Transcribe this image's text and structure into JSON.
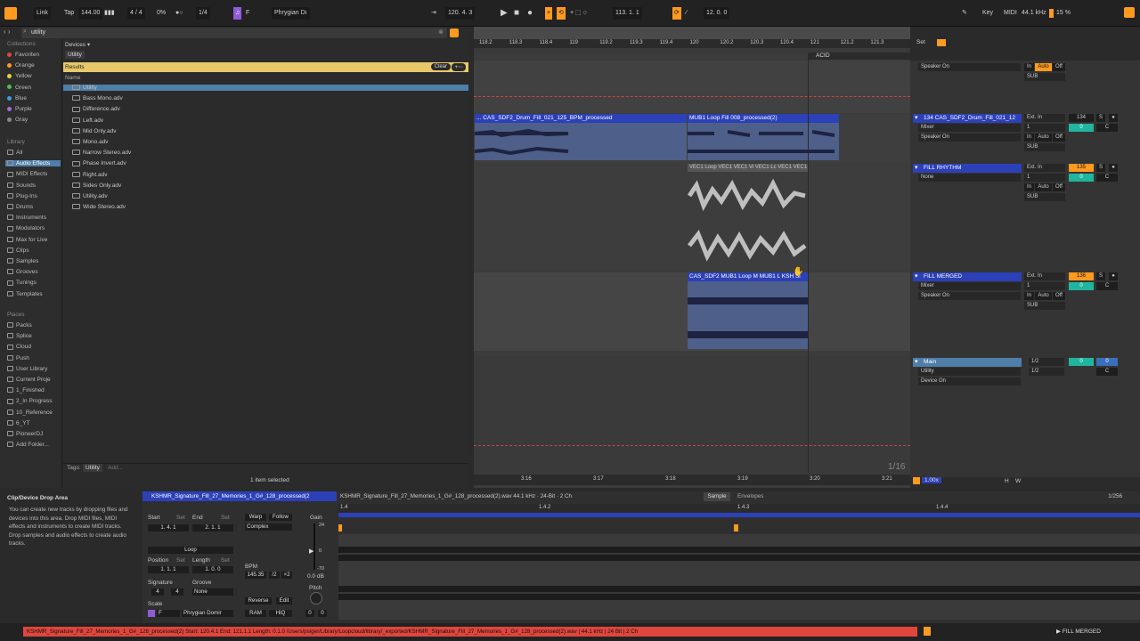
{
  "transport": {
    "link": "Link",
    "tap": "Tap",
    "tempo": "144.00",
    "signature": "4 / 4",
    "percent": "0%",
    "quant": "1/4",
    "key": "F",
    "scale": "Phrygian Dı",
    "position": "120.  4.  3",
    "loop_start": "113.   1.   1",
    "loop_len": "12.   0.   0",
    "key_label": "Key",
    "midi_label": "MIDI",
    "sample_rate": "44.1 kHz",
    "cpu": "15 %"
  },
  "browser": {
    "search_value": "utility",
    "breadcrumb": "Devices",
    "tag": "Utility",
    "results_label": "Results",
    "clear_label": "Clear",
    "column_name": "Name",
    "footer_tags_label": "Tags:",
    "footer_tag": "Utility",
    "footer_add": "Add...",
    "footer_status": "1 item selected",
    "collections_header": "Collections",
    "collections": [
      {
        "label": "Favoriten",
        "color": "#e0463c"
      },
      {
        "label": "Orange",
        "color": "#ff9a1f"
      },
      {
        "label": "Yellow",
        "color": "#e8d23c"
      },
      {
        "label": "Green",
        "color": "#4cc14a"
      },
      {
        "label": "Blue",
        "color": "#3aa0e0"
      },
      {
        "label": "Purple",
        "color": "#a86ad6"
      },
      {
        "label": "Gray",
        "color": "#8a8a8a"
      }
    ],
    "library_header": "Library",
    "library": [
      "All",
      "Audio Effects",
      "MIDI Effects",
      "Sounds",
      "Plug-Ins",
      "Drums",
      "Instruments",
      "Modulators",
      "Max for Live",
      "Clips",
      "Samples",
      "Grooves",
      "Tunings",
      "Templates"
    ],
    "places_header": "Places",
    "places": [
      "Packs",
      "Splice",
      "Cloud",
      "Push",
      "User Library",
      "Current Proje",
      "1_Finished",
      "2_In Progress",
      "10_Reference",
      "6_YT",
      "PioneerDJ",
      "Add Folder..."
    ],
    "files": [
      "Utility",
      "Bass Mono.adv",
      "Difference.adv",
      "Left.adv",
      "Mid Only.adv",
      "Mono.adv",
      "Narrow Stereo.adv",
      "Phase Invert.adv",
      "Right.adv",
      "Sides Only.adv",
      "Utility.adv",
      "Wide Stereo.adv"
    ]
  },
  "arrangement": {
    "ruler": [
      "118.2",
      "118.3",
      "118.4",
      "119",
      "119.2",
      "119.3",
      "119.4",
      "120",
      "120.2",
      "120.3",
      "120.4",
      "121",
      "121.2",
      "121.3"
    ],
    "time_ruler": [
      "3:16",
      "3:17",
      "3:18",
      "3:19",
      "3:20",
      "3:21"
    ],
    "locator": "ACID",
    "zoom": "1/16",
    "set_label": "Set",
    "clips": {
      "drum1": "... CAS_SDF2_Drum_Fill_021_125_BPM_processed",
      "drum2": "MUB1 Loop Fill 008_processed(2)",
      "rhythm": "VEC1 Loop VEC1 VEC1 Vi VEC1 Lc VEC1 VEC1",
      "merged": "CAS_SDF2 MUB1 Loop M MUB1 L KSH  Si"
    }
  },
  "mixer": {
    "tracks": [
      {
        "name": "",
        "out1": "Speaker On",
        "in": "In",
        "auto": "Auto",
        "off": "Off",
        "sub": "SUB"
      },
      {
        "name": "134 CAS_SDF2_Drum_Fill_021_12",
        "in_sel": "Ext. In",
        "ch": "1",
        "mix": "Mixer",
        "out1": "Speaker On",
        "num": "134",
        "vol": "0",
        "pan": "C",
        "s": "S",
        "sub": "SUB",
        "in": "In",
        "auto": "Auto",
        "off": "Off"
      },
      {
        "name": "FILL RHYTHM",
        "in_sel": "Ext. In",
        "ch": "1",
        "mix": "None",
        "num": "135",
        "vol": "0",
        "pan": "C",
        "s": "S",
        "sub": "SUB",
        "in": "In",
        "auto": "Auto",
        "off": "Off"
      },
      {
        "name": "FILL MERGED",
        "in_sel": "Ext. In",
        "ch": "1",
        "mix": "Mixer",
        "out1": "Speaker On",
        "num": "136",
        "vol": "0",
        "pan": "C",
        "s": "S",
        "sub": "SUB",
        "in": "In",
        "auto": "Auto",
        "off": "Off"
      }
    ],
    "main": {
      "name": "Main",
      "dev": "Utility",
      "dev_on": "Device On",
      "q1": "1/2",
      "q2": "1/2",
      "vol": "0",
      "vol2": "0",
      "pan": "C"
    },
    "zoom": "1.00x"
  },
  "info": {
    "title": "Clip/Device Drop Area",
    "body": "You can create new tracks by dropping files and devices into this area. Drop MIDI files, MIDI effects and instruments to create MIDI tracks. Drop samples and audio effects to create audio tracks."
  },
  "clip": {
    "name": "KSHMR_Signature_Fill_27_Memories_1_G#_128_processed(2",
    "file_info": "KSHMR_Signature_Fill_27_Memories_1_G#_128_processed(2).wav 44.1 kHz · 24-Bit · 2 Ch",
    "sample_tab": "Sample",
    "envelopes_tab": "Envelopes",
    "grid": "1/256",
    "start_label": "Start",
    "end_label": "End",
    "set_label": "Set",
    "start_val": "1.  4.  1",
    "end_val": "2.  1.  1",
    "loop_label": "Loop",
    "position_label": "Position",
    "length_label": "Length",
    "position_val": "1.  1.  1",
    "length_val": "1.  0.  0",
    "signature_label": "Signature",
    "groove_label": "Groove",
    "sig_num": "4",
    "sig_den": "4",
    "groove_val": "None",
    "scale_label": "Scale",
    "scale_key": "F",
    "scale_name": "Phrygian Domir",
    "warp_label": "Warp",
    "follow_label": "Follow",
    "warp_mode": "Complex",
    "bpm_label": "BPM",
    "bpm_val": "145.35",
    "half": "/2",
    "double": "×2",
    "reverse_label": "Reverse",
    "edit_label": "Edit",
    "ram_label": "RAM",
    "hiq_label": "HiQ",
    "gain_label": "Gain",
    "gain_val": "0.0 dB",
    "gain_top": "24",
    "gain_zero": "0",
    "gain_bottom": "-70",
    "pitch_label": "Pitch",
    "pitch_a": "0",
    "pitch_b": "0",
    "ruler": [
      "1.4",
      "1.4.2",
      "1.4.3",
      "1.4.4"
    ]
  },
  "status": {
    "text": "KSHMR_Signature_Fill_27_Memories_1_G#_128_processed(2) Start: 120.4.1 End: 121.1.1 Length: 0.1.0 /Users/psiger/Library/Loopcloud/library/_exported/KSHMR_Signature_Fill_27_Memories_1_G#_128_processed(2).wav | 44.1 kHz | 24 Bit | 2 Ch",
    "track": "FILL MERGED"
  },
  "colors": {
    "accent": "#ff9a1f",
    "clip_blue": "#2c40b8",
    "selection": "#4f7ea8"
  }
}
